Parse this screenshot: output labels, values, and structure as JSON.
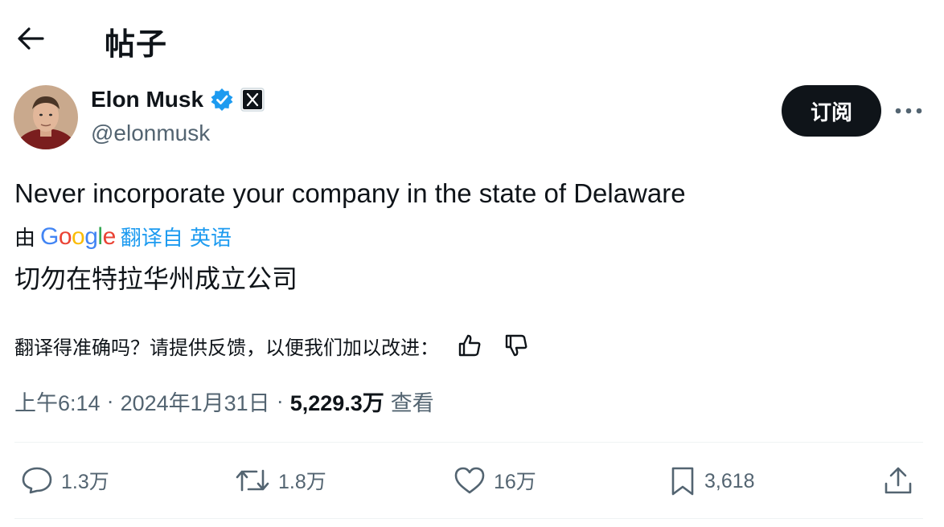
{
  "header": {
    "title": "帖子",
    "back_icon": "arrow-left-icon"
  },
  "author": {
    "name": "Elon Musk",
    "handle": "@elonmusk",
    "verified_color": "#1d9bf0",
    "affiliation_icon": "x-logo-icon"
  },
  "subscribe_label": "订阅",
  "tweet": {
    "text": "Never incorporate your company in the state of Delaware",
    "translation": {
      "by_prefix": "由",
      "provider": "Google",
      "from_label": "翻译自 英语",
      "text": "切勿在特拉华州成立公司"
    },
    "feedback_prompt": "翻译得准确吗？请提供反馈，以便我们加以改进："
  },
  "meta": {
    "time": "上午6:14",
    "date": "2024年1月31日",
    "views_count": "5,229.3万",
    "views_label": "查看"
  },
  "actions": {
    "replies": "1.3万",
    "reposts": "1.8万",
    "likes": "16万",
    "bookmarks": "3,618"
  },
  "colors": {
    "accent": "#1d9bf0",
    "text": "#0f1419",
    "muted": "#536471"
  }
}
